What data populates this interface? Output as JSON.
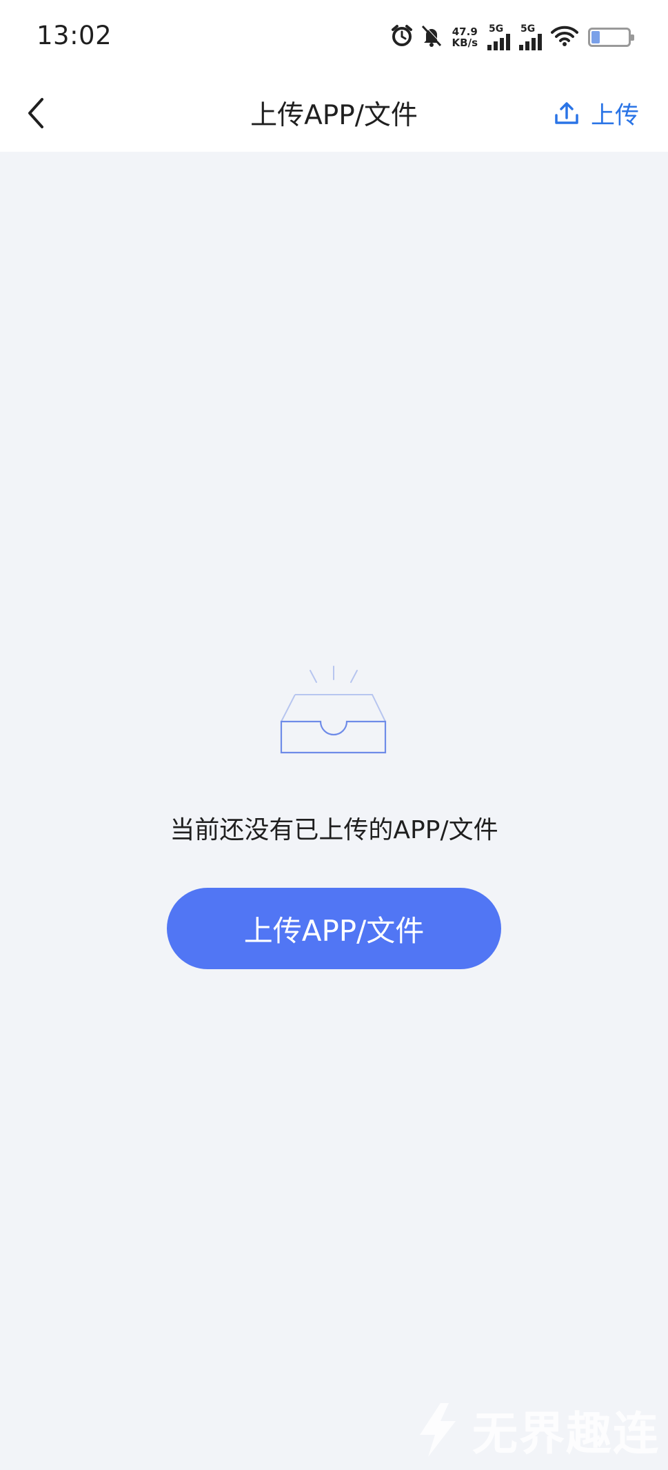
{
  "status_bar": {
    "time": "13:02",
    "net_speed_value": "47.9",
    "net_speed_unit": "KB/s",
    "sim1_label": "5G",
    "sim2_label": "5G",
    "battery_level": "21",
    "icons": [
      "alarm-icon",
      "bell-muted-icon",
      "signal-icon",
      "signal-icon",
      "wifi-icon",
      "battery-icon"
    ]
  },
  "nav": {
    "title": "上传APP/文件",
    "upload_label": "上传",
    "accent_color": "#2a74e6"
  },
  "empty_state": {
    "message": "当前还没有已上传的APP/文件",
    "button_label": "上传APP/文件",
    "button_color": "#5176f4"
  },
  "watermark": {
    "text": "无界趣连"
  }
}
